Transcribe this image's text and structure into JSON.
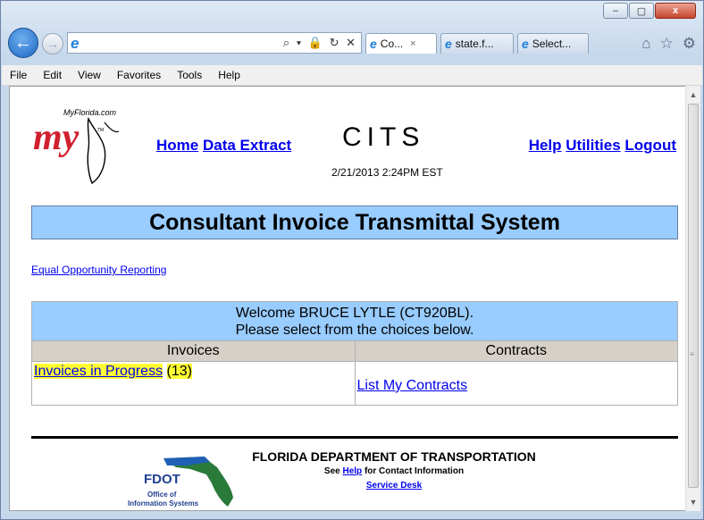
{
  "browser": {
    "window_buttons": [
      "–",
      "▢",
      "x"
    ],
    "address": {
      "value": "",
      "tools": "⌕ ▾ 🔒 ↻ ✕"
    },
    "tabs": [
      {
        "label": "Co...",
        "close": "×"
      },
      {
        "label": "state.f..."
      },
      {
        "label": "Select..."
      }
    ],
    "menu": [
      "File",
      "Edit",
      "View",
      "Favorites",
      "Tools",
      "Help"
    ]
  },
  "header": {
    "logo_tag": "MyFlorida.com",
    "logo_word": "my",
    "logo_tm": "TM",
    "nav_left": [
      "Home",
      "Data Extract"
    ],
    "app_title": "CITS",
    "timestamp": "2/21/2013   2:24PM EST",
    "nav_right": [
      "Help",
      "Utilities",
      "Logout"
    ]
  },
  "banner": "Consultant Invoice Transmittal System",
  "eor_link": "Equal Opportunity Reporting",
  "panel": {
    "welcome_line1": "Welcome BRUCE LYTLE (CT920BL).",
    "welcome_line2": "Please select from the choices below.",
    "col_invoices": "Invoices",
    "col_contracts": "Contracts",
    "invoices_link": "Invoices in Progress",
    "invoices_count": "(13)",
    "contracts_link": "List My Contracts"
  },
  "footer": {
    "fdot_abbr": "FDOT",
    "fdot_line1": "Office of",
    "fdot_line2": "Information Systems",
    "org": "FLORIDA DEPARTMENT OF TRANSPORTATION",
    "see": "See",
    "help_link": "Help",
    "for_contact": "for Contact Information",
    "service_desk": "Service Desk"
  }
}
